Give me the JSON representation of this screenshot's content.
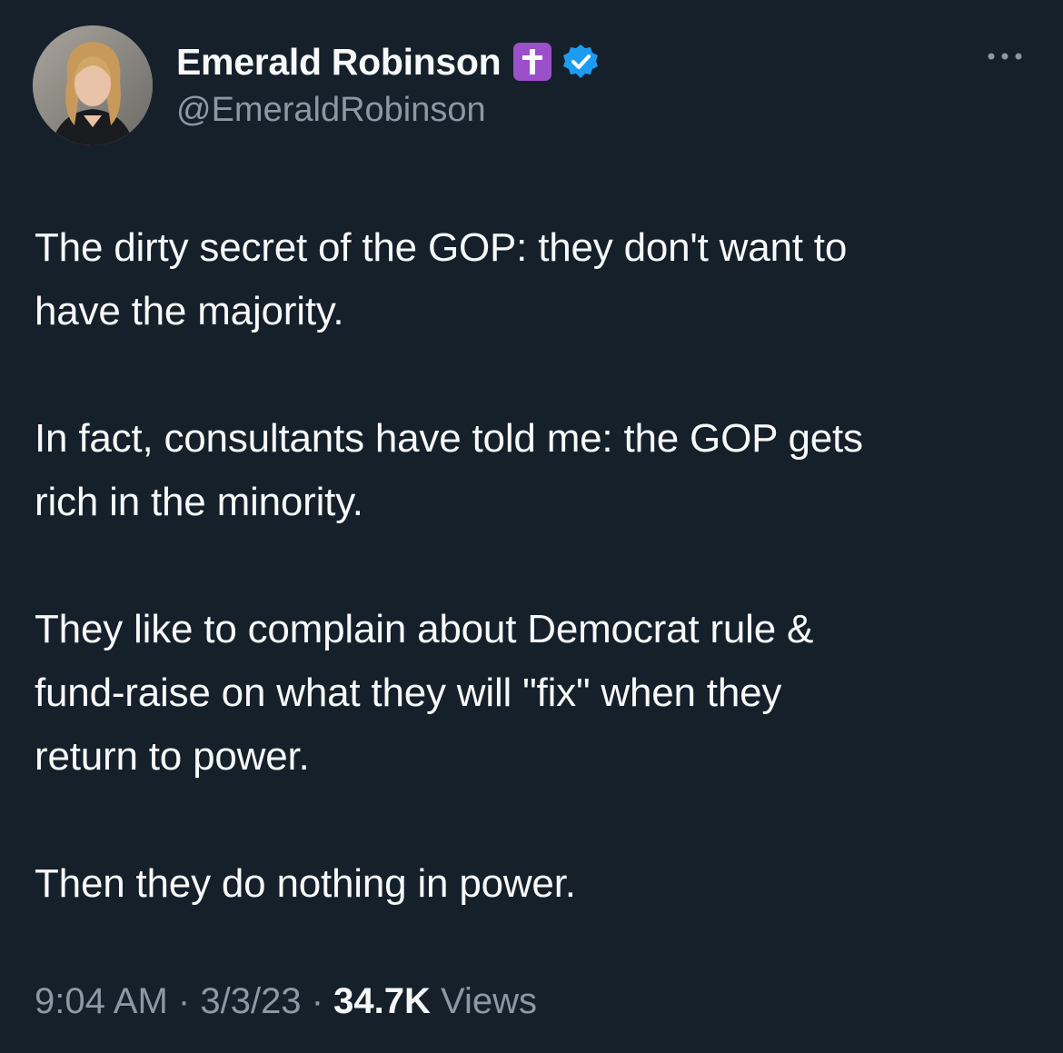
{
  "author": {
    "display_name": "Emerald Robinson",
    "handle": "@EmeraldRobinson",
    "badge_emoji": "cross-emoji",
    "verified_icon": "verified-badge-icon",
    "verified_color": "#1d9bf0",
    "badge_color": "#9b4fc9"
  },
  "tweet": {
    "paragraphs": [
      "The dirty secret of the GOP: they don't want to\nhave the majority.",
      "In fact, consultants have told me: the GOP gets\nrich in the minority.",
      "They like to complain about Democrat rule &\nfund-raise on what they will \"fix\" when they\nreturn to power.",
      "Then they do nothing in power."
    ]
  },
  "meta": {
    "time": "9:04 AM",
    "separator": "·",
    "date": "3/3/23",
    "views_count": "34.7K",
    "views_label": "Views"
  },
  "colors": {
    "background": "#15202b",
    "text_primary": "#f7f9f9",
    "text_secondary": "#8b98a5"
  }
}
